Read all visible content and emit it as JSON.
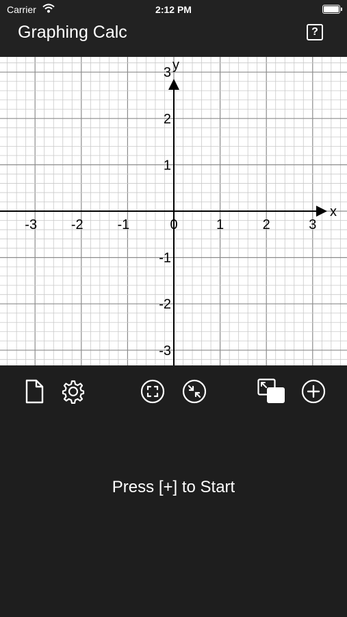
{
  "status_bar": {
    "carrier": "Carrier",
    "time": "2:12 PM"
  },
  "nav": {
    "title": "Graphing Calc",
    "help_label": "?"
  },
  "graph": {
    "axis_x_label": "x",
    "axis_y_label": "y",
    "x_range": [
      -3.75,
      3.75
    ],
    "y_range": [
      -3.3,
      3.3
    ],
    "x_ticks": [
      "-3",
      "-2",
      "-1",
      "0",
      "1",
      "2",
      "3"
    ],
    "y_ticks": [
      "3",
      "2",
      "1",
      "-1",
      "-2",
      "-3"
    ],
    "minor_grid_per_unit": 5,
    "grid": true
  },
  "toolbar": {
    "icons": [
      "document-icon",
      "gear-icon",
      "fit-screen-icon",
      "shrink-icon",
      "overlap-windows-icon",
      "add-icon"
    ]
  },
  "main": {
    "prompt": "Press [+] to Start"
  },
  "colors": {
    "chrome": "#222222",
    "panel": "#1e1e1e",
    "graph_bg": "#ffffff",
    "axis": "#000000"
  }
}
